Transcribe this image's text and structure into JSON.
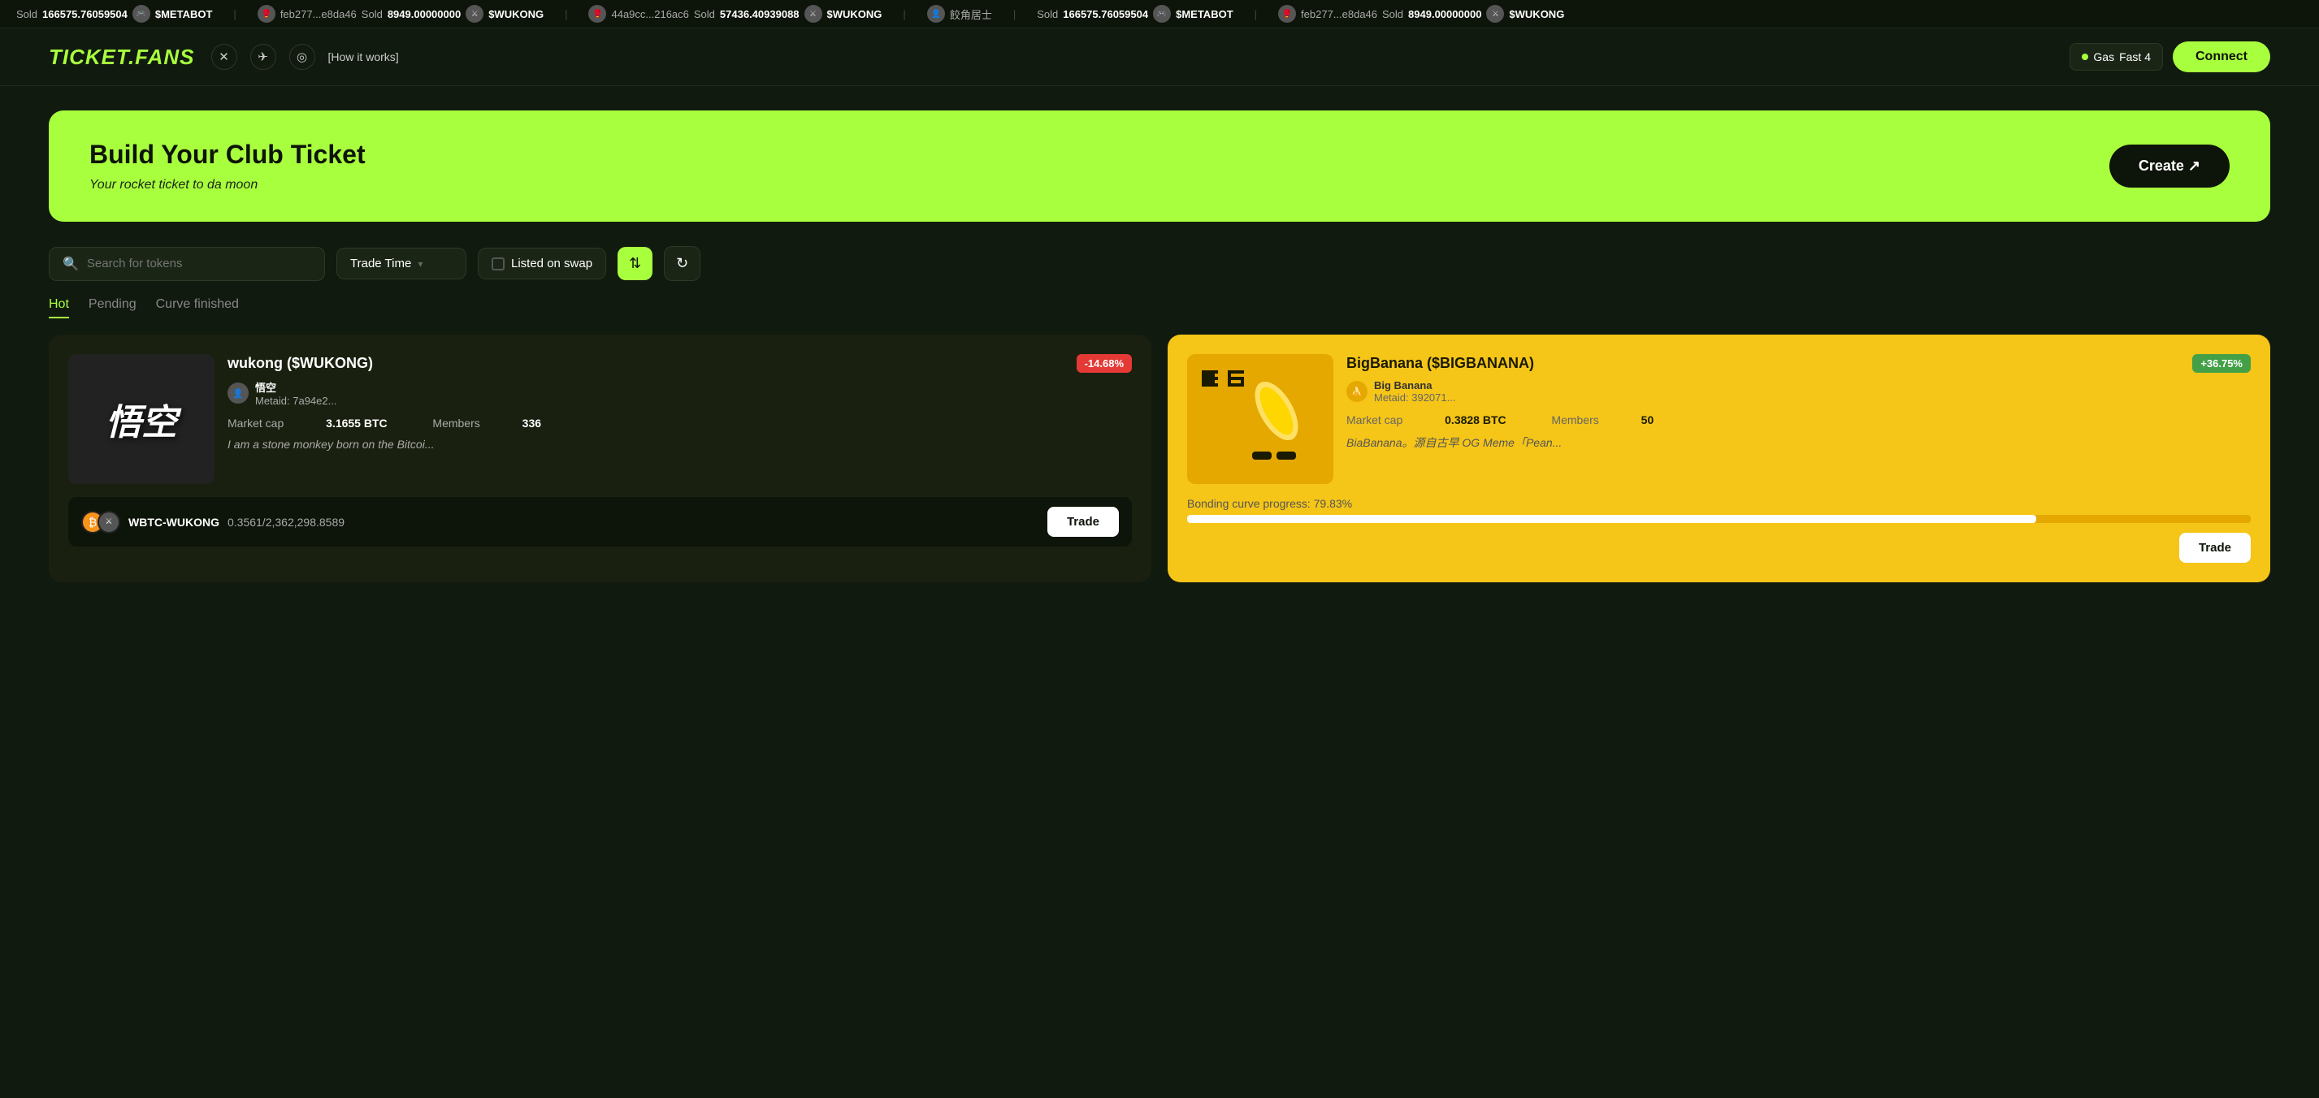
{
  "ticker": {
    "items": [
      {
        "action": "Sold",
        "amount": "166575.76059504",
        "icon": "🎮",
        "token": "$METABOT"
      },
      {
        "action": "Sold",
        "amount": "8949.00000000",
        "address": "feb277...e8da46",
        "icon": "🥊",
        "token": "$WUKONG"
      },
      {
        "action": "Sold",
        "amount": "57436.40939088",
        "address": "44a9cc...216ac6",
        "icon": "🥊",
        "token": "$WUKONG"
      }
    ]
  },
  "header": {
    "logo": "TiCKET.FANS",
    "nav_links": [
      "x-icon",
      "telegram-icon",
      "discord-icon"
    ],
    "how_it_works": "[How it works]",
    "gas_label": "Gas",
    "gas_value": "Fast 4",
    "connect_label": "Connect"
  },
  "hero": {
    "title": "Build Your Club Ticket",
    "subtitle": "Your rocket ticket to da moon",
    "create_label": "Create ↗"
  },
  "filter": {
    "search_placeholder": "Search for tokens",
    "sort_label": "Trade Time",
    "listed_swap_label": "Listed on swap",
    "sort_icon": "⇅",
    "refresh_icon": "↻"
  },
  "tabs": [
    {
      "label": "Hot",
      "active": true
    },
    {
      "label": "Pending",
      "active": false
    },
    {
      "label": "Curve finished",
      "active": false
    }
  ],
  "cards": [
    {
      "id": "wukong",
      "theme": "dark",
      "title": "wukong ($WUKONG)",
      "badge": "-14.68%",
      "badge_type": "negative",
      "creator_name": "悟空",
      "creator_meta": "Metaid: 7a94e2...",
      "market_cap_label": "Market cap",
      "market_cap_value": "3.1655 BTC",
      "members_label": "Members",
      "members_value": "336",
      "description": "I am a stone monkey born on the Bitcoi...",
      "pair_label": "WBTC-WUKONG",
      "pair_amount": "0.3561/2,362,298.8589",
      "trade_label": "Trade"
    },
    {
      "id": "bigbanana",
      "theme": "yellow",
      "title": "BigBanana ($BIGBANANA)",
      "badge": "+36.75%",
      "badge_type": "positive",
      "creator_name": "Big Banana",
      "creator_meta": "Metaid: 392071...",
      "market_cap_label": "Market cap",
      "market_cap_value": "0.3828 BTC",
      "members_label": "Members",
      "members_value": "50",
      "description": "BiaBanana。源自古早 OG Meme「Pean...",
      "bonding_label": "Bonding curve progress: 79.83%",
      "bonding_percent": 79.83,
      "trade_label": "Trade"
    }
  ]
}
